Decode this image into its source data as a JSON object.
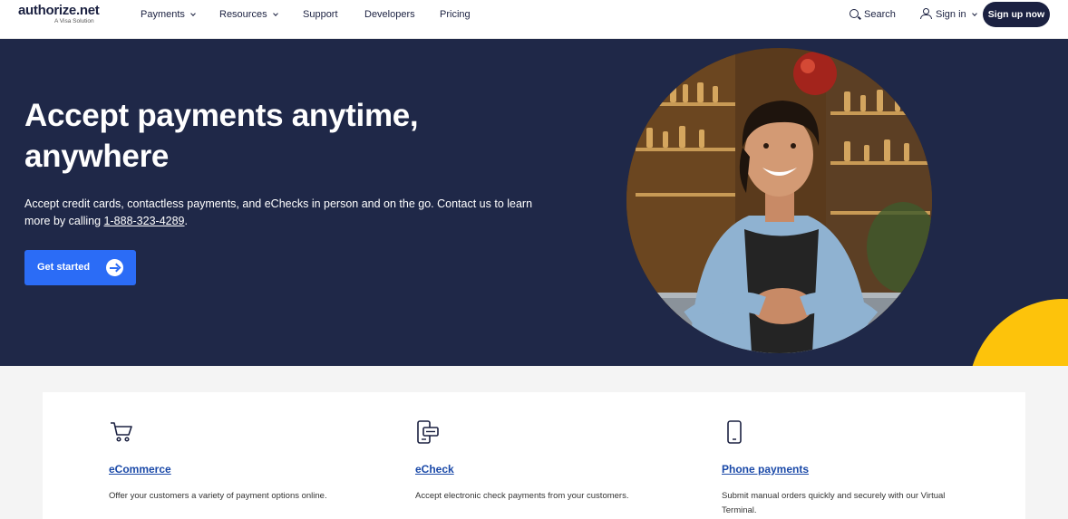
{
  "header": {
    "logo_main": "authorize.net",
    "logo_sub": "A Visa Solution",
    "nav": [
      {
        "label": "Payments",
        "dropdown": true
      },
      {
        "label": "Resources",
        "dropdown": true
      },
      {
        "label": "Support",
        "dropdown": false
      },
      {
        "label": "Developers",
        "dropdown": false
      },
      {
        "label": "Pricing",
        "dropdown": false
      }
    ],
    "search_label": "Search",
    "signin_label": "Sign in",
    "signup_label": "Sign up now"
  },
  "hero": {
    "title": "Accept payments anytime, anywhere",
    "desc_before": "Accept credit cards, contactless payments, and eChecks in person and on the go. Contact us to learn more by calling ",
    "phone": "1-888-323-4289",
    "desc_after": ".",
    "cta_label": "Get started"
  },
  "features": [
    {
      "icon": "shopping-cart-icon",
      "title": "eCommerce",
      "desc": "Offer your customers a variety of payment options online."
    },
    {
      "icon": "echeck-icon",
      "title": "eCheck",
      "desc": "Accept electronic check payments from your customers."
    },
    {
      "icon": "smartphone-icon",
      "title": "Phone payments",
      "desc": "Submit manual orders quickly and securely with our Virtual Terminal."
    }
  ],
  "colors": {
    "navy": "#1f2848",
    "brand_dark": "#1b2141",
    "cta_blue": "#2b6cf6",
    "accent_yellow": "#fdc30b",
    "link_blue": "#1a49a8"
  }
}
